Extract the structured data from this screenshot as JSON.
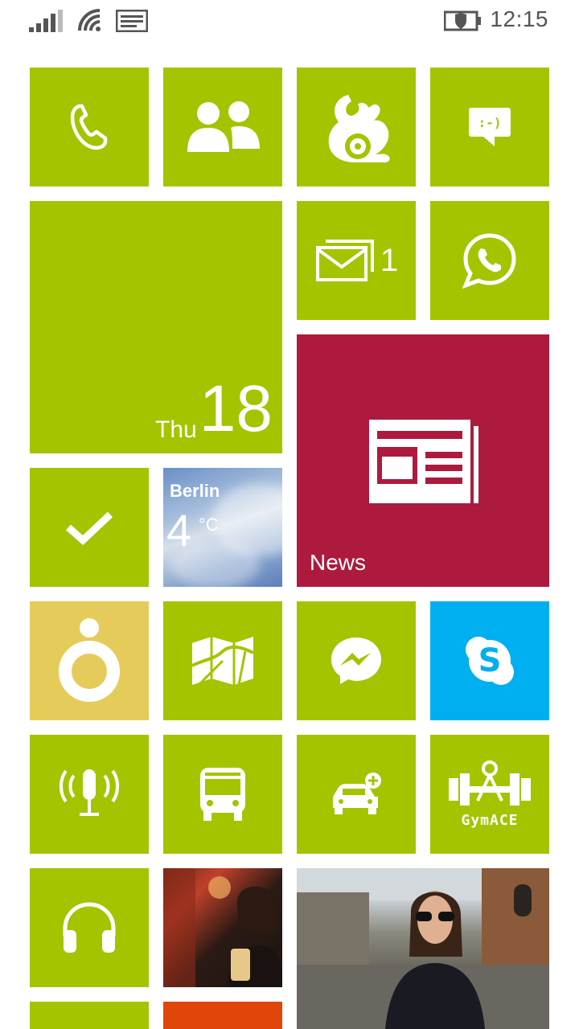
{
  "status_bar": {
    "time": "12:15",
    "icons": [
      "signal-bars-icon",
      "wifi-icon",
      "message-notification-icon",
      "battery-saver-icon"
    ]
  },
  "colors": {
    "accent": "#a4c400",
    "news": "#ad1a3e",
    "skype": "#00aff0",
    "yellow_tile": "#e5cc5a",
    "orange_tile": "#e0450a"
  },
  "tiles": {
    "calendar": {
      "day": "Thu",
      "date": "18"
    },
    "email": {
      "count": "1"
    },
    "weather": {
      "city": "Berlin",
      "temp": "4",
      "unit": "°C"
    },
    "news": {
      "label": "News"
    },
    "gymace": {
      "label": "GymACE"
    }
  }
}
